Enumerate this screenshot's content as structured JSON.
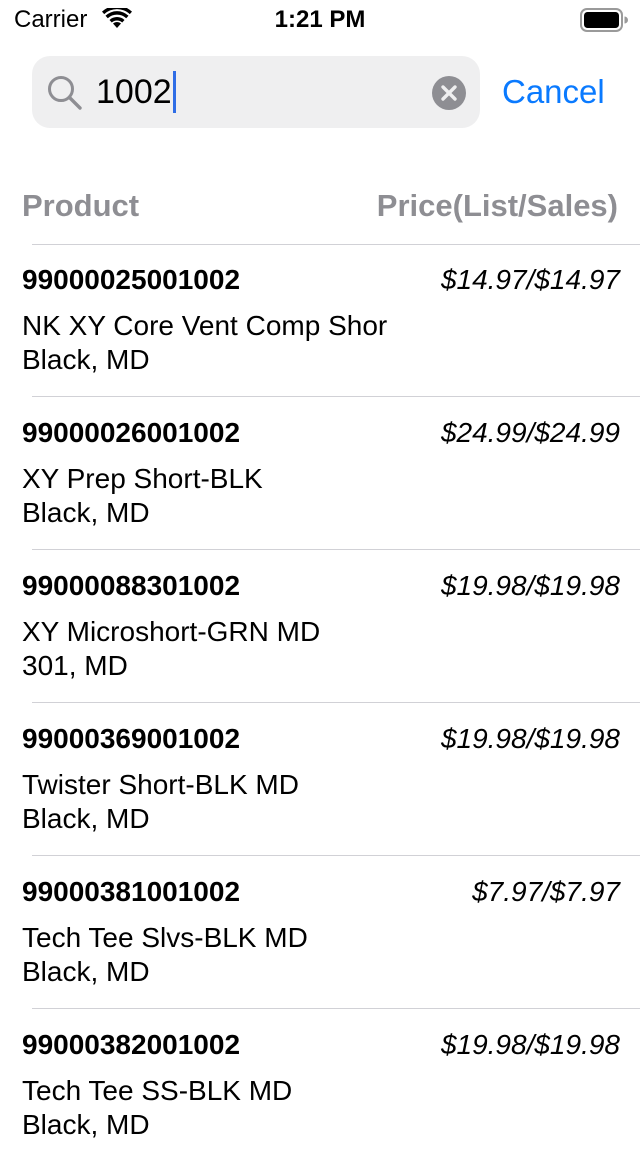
{
  "status_bar": {
    "carrier": "Carrier",
    "time": "1:21 PM"
  },
  "search": {
    "value": "1002",
    "cancel_label": "Cancel"
  },
  "header": {
    "product": "Product",
    "price": "Price(List/Sales)"
  },
  "products": [
    {
      "sku": "99000025001002",
      "price": "$14.97/$14.97",
      "name": "NK XY Core Vent Comp Shor",
      "variant": "Black, MD"
    },
    {
      "sku": "99000026001002",
      "price": "$24.99/$24.99",
      "name": "XY Prep Short-BLK",
      "variant": "Black, MD"
    },
    {
      "sku": "99000088301002",
      "price": "$19.98/$19.98",
      "name": "XY Microshort-GRN MD",
      "variant": "301, MD"
    },
    {
      "sku": "99000369001002",
      "price": "$19.98/$19.98",
      "name": "Twister Short-BLK MD",
      "variant": "Black, MD"
    },
    {
      "sku": "99000381001002",
      "price": "$7.97/$7.97",
      "name": "Tech Tee Slvs-BLK MD",
      "variant": "Black, MD"
    },
    {
      "sku": "99000382001002",
      "price": "$19.98/$19.98",
      "name": "Tech Tee SS-BLK MD",
      "variant": "Black, MD"
    }
  ],
  "colors": {
    "accent": "#0a7aff",
    "header_text": "#8e8e93",
    "search_background": "#efeff0",
    "caret": "#2f6de6"
  }
}
